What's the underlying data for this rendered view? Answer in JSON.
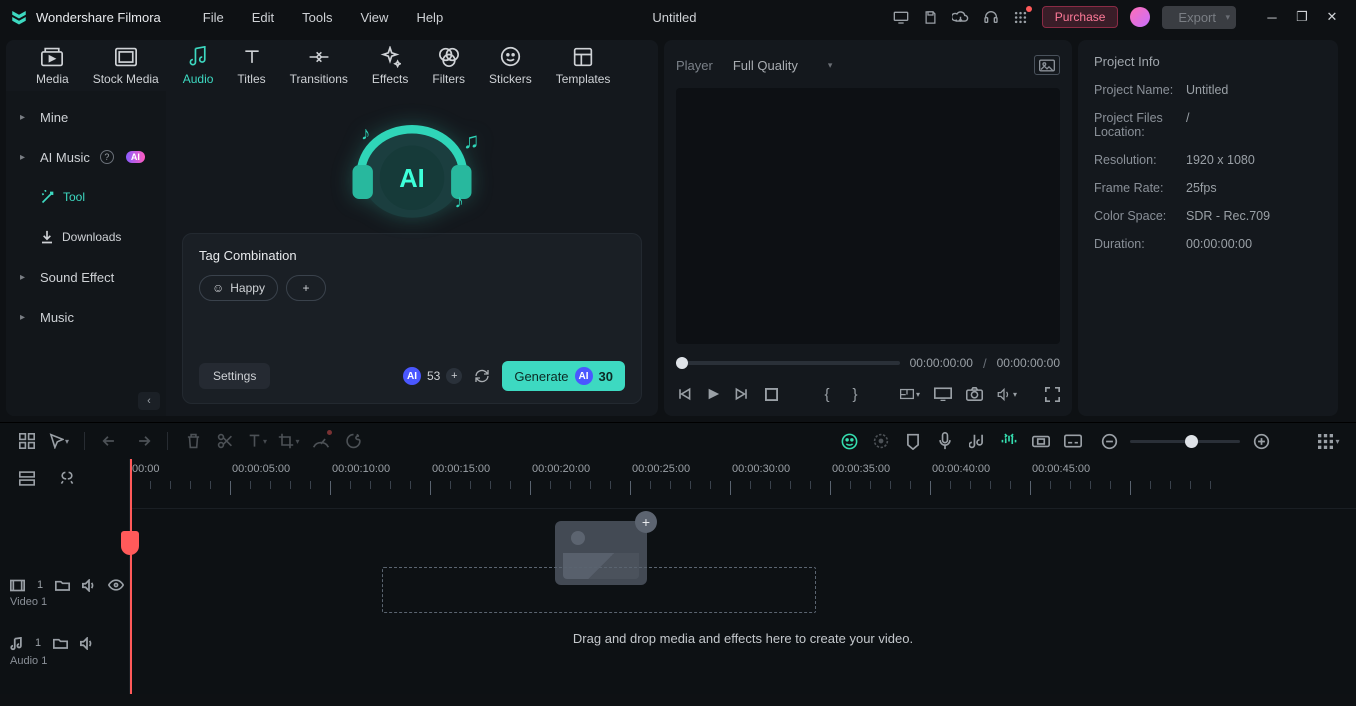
{
  "app": {
    "name": "Wondershare Filmora",
    "document": "Untitled",
    "purchase": "Purchase",
    "export": "Export"
  },
  "menu": [
    "File",
    "Edit",
    "Tools",
    "View",
    "Help"
  ],
  "tabs": [
    {
      "label": "Media"
    },
    {
      "label": "Stock Media"
    },
    {
      "label": "Audio"
    },
    {
      "label": "Titles"
    },
    {
      "label": "Transitions"
    },
    {
      "label": "Effects"
    },
    {
      "label": "Filters"
    },
    {
      "label": "Stickers"
    },
    {
      "label": "Templates"
    }
  ],
  "tabs_active": 2,
  "sidebar": {
    "items": [
      {
        "label": "Mine",
        "kind": "group"
      },
      {
        "label": "AI Music",
        "kind": "group",
        "ai": true
      },
      {
        "label": "Tool",
        "kind": "sub",
        "icon": "wand",
        "active": true
      },
      {
        "label": "Downloads",
        "kind": "sub",
        "icon": "download"
      },
      {
        "label": "Sound Effect",
        "kind": "group"
      },
      {
        "label": "Music",
        "kind": "group"
      }
    ]
  },
  "tag": {
    "title": "Tag Combination",
    "tags": [
      {
        "icon": "smile",
        "label": "Happy"
      }
    ],
    "settings": "Settings",
    "credits": "53",
    "generate": "Generate",
    "gen_count": "30"
  },
  "player": {
    "label": "Player",
    "quality": "Full Quality",
    "current": "00:00:00:00",
    "total": "00:00:00:00"
  },
  "info": {
    "title": "Project Info",
    "rows": [
      {
        "k": "Project Name:",
        "v": "Untitled"
      },
      {
        "k": "Project Files Location:",
        "v": "/"
      },
      {
        "k": "Resolution:",
        "v": "1920 x 1080"
      },
      {
        "k": "Frame Rate:",
        "v": "25fps"
      },
      {
        "k": "Color Space:",
        "v": "SDR - Rec.709"
      },
      {
        "k": "Duration:",
        "v": "00:00:00:00"
      }
    ]
  },
  "timeline": {
    "ruler": [
      "00:00",
      "00:00:05:00",
      "00:00:10:00",
      "00:00:15:00",
      "00:00:20:00",
      "00:00:25:00",
      "00:00:30:00",
      "00:00:35:00",
      "00:00:40:00",
      "00:00:45:00"
    ],
    "tracks": [
      {
        "name": "Video 1",
        "icons": [
          "film",
          "folder",
          "speaker",
          "eye"
        ]
      },
      {
        "name": "Audio 1",
        "icons": [
          "note",
          "folder",
          "speaker"
        ]
      }
    ],
    "drop_hint": "Drag and drop media and effects here to create your video."
  }
}
